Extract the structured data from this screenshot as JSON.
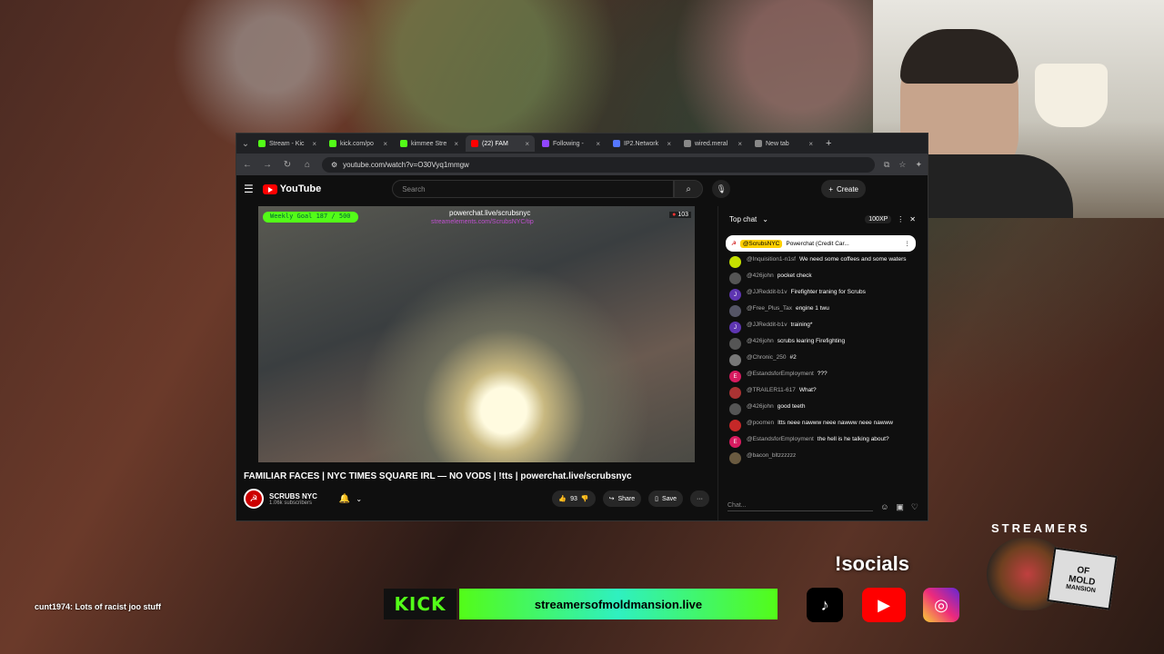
{
  "browser": {
    "tabs": [
      {
        "label": "Stream - Kic",
        "color": "#53fc18"
      },
      {
        "label": "kick.com/po",
        "color": "#53fc18"
      },
      {
        "label": "kimmee Stre",
        "color": "#53fc18"
      },
      {
        "label": "(22) FAM",
        "color": "#ff0000",
        "active": true
      },
      {
        "label": "Following -",
        "color": "#9146ff"
      },
      {
        "label": "IP2.Network",
        "color": "#5577ff"
      },
      {
        "label": "wired.meral",
        "color": "#888888"
      },
      {
        "label": "New tab",
        "color": "#888888"
      }
    ],
    "new_tab_symbol": "+",
    "url": "youtube.com/watch?v=O30Vyq1mmgw"
  },
  "youtube": {
    "logo": "YouTube",
    "search_placeholder": "Search",
    "create_label": "Create",
    "video": {
      "goal": "Weekly Goal 187 / 500",
      "overlay_url": "powerchat.live/scrubsnyc",
      "overlay_url2": "streamelements.com/ScrubsNYC/tip",
      "viewers": "103",
      "title": "FAMILIAR FACES | NYC TIMES SQUARE IRL — NO VODS | !tts | powerchat.live/scrubsnyc"
    },
    "channel": {
      "name": "SCRUBS NYC",
      "subs": "1.06k subscribers"
    },
    "actions": {
      "likes": "93",
      "share": "Share",
      "save": "Save",
      "more": "···"
    }
  },
  "chat": {
    "header": "Top chat",
    "xp": "100XP",
    "pinned_user": "@ScrubsNYC",
    "pinned_text": "Powerchat (Credit Car...",
    "messages": [
      {
        "user": "@Inquisition1-n1sf",
        "text": "We need some coffees and some waters",
        "color": "#c5e000"
      },
      {
        "user": "@426john",
        "text": "pocket check",
        "color": "#555"
      },
      {
        "user": "@JJReddit-b1v",
        "text": "Firefighter traning for Scrubs",
        "color": "#5e35b1",
        "initial": "J"
      },
      {
        "user": "@Free_Plus_Tax",
        "text": "engine 1 twu",
        "color": "#556"
      },
      {
        "user": "@JJReddit-b1v",
        "text": "training*",
        "color": "#5e35b1",
        "initial": "J"
      },
      {
        "user": "@426john",
        "text": "scrubs learing Firefighting",
        "color": "#555"
      },
      {
        "user": "@Chronic_250",
        "text": "#2",
        "color": "#777"
      },
      {
        "user": "@EstandsforEmployment",
        "text": "???",
        "color": "#d81b60",
        "initial": "E"
      },
      {
        "user": "@TRAILER11-617",
        "text": "What?",
        "color": "#a33"
      },
      {
        "user": "@426john",
        "text": "good teeth",
        "color": "#555"
      },
      {
        "user": "@poomen",
        "text": "Itts neee nawww neee nawww neee nawww",
        "color": "#c62828"
      },
      {
        "user": "@EstandsforEmployment",
        "text": "the hell is he talking about?",
        "color": "#d81b60",
        "initial": "E"
      },
      {
        "user": "@bacon_bltzzzzzz",
        "text": "",
        "color": "#6a5a40"
      }
    ],
    "input_placeholder": "Chat..."
  },
  "overlay": {
    "bottom_chat": "cunt1974: Lots of racist joo stuff",
    "kick_label": "KICK",
    "site": "streamersofmoldmansion.live",
    "socials": "!socials",
    "badge_title": "STREAMERS",
    "badge_of": "OF",
    "badge_mold": "MOLD",
    "badge_mansion": "MANSION"
  }
}
